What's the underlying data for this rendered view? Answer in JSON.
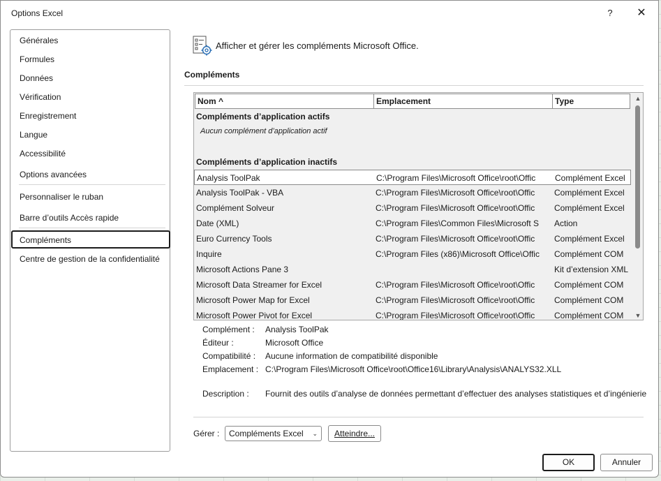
{
  "window": {
    "title": "Options Excel",
    "help_label": "?",
    "close_label": "✕"
  },
  "nav": {
    "items": [
      "Générales",
      "Formules",
      "Données",
      "Vérification",
      "Enregistrement",
      "Langue",
      "Accessibilité",
      "Options avancées",
      "Personnaliser le ruban",
      "Barre d’outils Accès rapide",
      "Compléments",
      "Centre de gestion de la confidentialité"
    ],
    "selected": "Compléments"
  },
  "header": {
    "text": "Afficher et gérer les compléments Microsoft Office.",
    "icon": "addins-gear-icon"
  },
  "section_title": "Compléments",
  "table": {
    "columns": [
      "Nom ^",
      "Emplacement",
      "Type"
    ],
    "active_group_title": "Compléments d’application actifs",
    "active_group_empty": "Aucun complément d’application actif",
    "inactive_group_title": "Compléments d’application inactifs",
    "rows": [
      {
        "name": "Analysis ToolPak",
        "location": "C:\\Program Files\\Microsoft Office\\root\\Offic",
        "type": "Complément Excel",
        "selected": true
      },
      {
        "name": "Analysis ToolPak - VBA",
        "location": "C:\\Program Files\\Microsoft Office\\root\\Offic",
        "type": "Complément Excel"
      },
      {
        "name": "Complément Solveur",
        "location": "C:\\Program Files\\Microsoft Office\\root\\Offic",
        "type": "Complément Excel"
      },
      {
        "name": "Date (XML)",
        "location": "C:\\Program Files\\Common Files\\Microsoft S",
        "type": "Action"
      },
      {
        "name": "Euro Currency Tools",
        "location": "C:\\Program Files\\Microsoft Office\\root\\Offic",
        "type": "Complément Excel"
      },
      {
        "name": "Inquire",
        "location": "C:\\Program Files (x86)\\Microsoft Office\\Offic",
        "type": "Complément COM"
      },
      {
        "name": "Microsoft Actions Pane 3",
        "location": "",
        "type": "Kit d’extension XML"
      },
      {
        "name": "Microsoft Data Streamer for Excel",
        "location": "C:\\Program Files\\Microsoft Office\\root\\Offic",
        "type": "Complément COM"
      },
      {
        "name": "Microsoft Power Map for Excel",
        "location": "C:\\Program Files\\Microsoft Office\\root\\Offic",
        "type": "Complément COM"
      },
      {
        "name": "Microsoft Power Pivot for Excel",
        "location": "C:\\Program Files\\Microsoft Office\\root\\Offic",
        "type": "Complément COM"
      }
    ]
  },
  "details": {
    "addin_label": "Complément :",
    "addin_value": "Analysis ToolPak",
    "publisher_label": "Éditeur :",
    "publisher_value": "Microsoft Office",
    "compat_label": "Compatibilité :",
    "compat_value": "Aucune information de compatibilité disponible",
    "location_label": "Emplacement :",
    "location_value": "C:\\Program Files\\Microsoft Office\\root\\Office16\\Library\\Analysis\\ANALYS32.XLL",
    "description_label": "Description :",
    "description_value": "Fournit des outils d’analyse de données permettant d’effectuer des analyses statistiques et d’ingénierie"
  },
  "manage": {
    "label": "Gérer :",
    "selected_option": "Compléments Excel",
    "goto_label": "Atteindre..."
  },
  "buttons": {
    "ok": "OK",
    "cancel": "Annuler"
  }
}
